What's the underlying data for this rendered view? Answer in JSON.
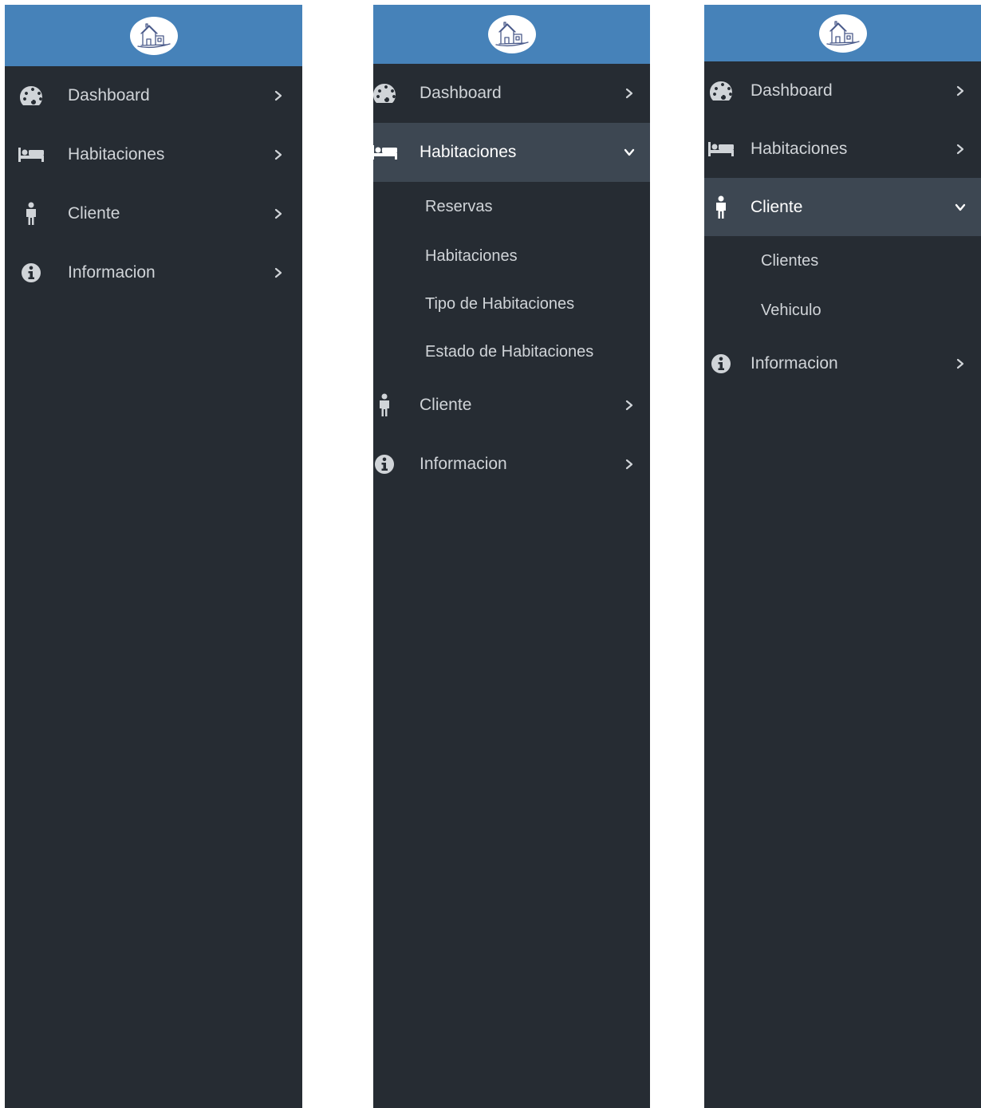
{
  "colors": {
    "header_bg": "#4682b9",
    "sidebar_bg": "#262c33",
    "active_bg": "#3d4752",
    "text": "#d0d4d8",
    "active_text": "#ffffff"
  },
  "panels": [
    {
      "expanded": null,
      "items": [
        {
          "label": "Dashboard",
          "icon": "dashboard-gauge-icon"
        },
        {
          "label": "Habitaciones",
          "icon": "bed-icon"
        },
        {
          "label": "Cliente",
          "icon": "person-icon"
        },
        {
          "label": "Informacion",
          "icon": "info-circle-icon"
        }
      ]
    },
    {
      "expanded": "Habitaciones",
      "items": [
        {
          "label": "Dashboard",
          "icon": "dashboard-gauge-icon"
        },
        {
          "label": "Habitaciones",
          "icon": "bed-icon",
          "subitems": [
            "Reservas",
            "Habitaciones",
            "Tipo de Habitaciones",
            "Estado de Habitaciones"
          ]
        },
        {
          "label": "Cliente",
          "icon": "person-icon"
        },
        {
          "label": "Informacion",
          "icon": "info-circle-icon"
        }
      ]
    },
    {
      "expanded": "Cliente",
      "items": [
        {
          "label": "Dashboard",
          "icon": "dashboard-gauge-icon"
        },
        {
          "label": "Habitaciones",
          "icon": "bed-icon"
        },
        {
          "label": "Cliente",
          "icon": "person-icon",
          "subitems": [
            "Clientes",
            "Vehiculo"
          ]
        },
        {
          "label": "Informacion",
          "icon": "info-circle-icon"
        }
      ]
    }
  ]
}
